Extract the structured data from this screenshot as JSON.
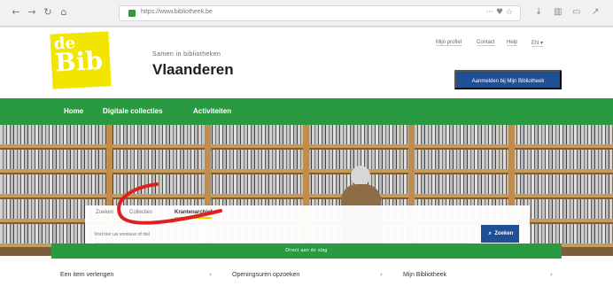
{
  "browser": {
    "nav_icons": [
      "←",
      "→",
      "↻",
      "⌂"
    ],
    "url": "https://www.bibliotheek.be",
    "url_right": "··· ♥ ☆",
    "toolbar_icons": [
      "↓",
      "▥",
      "▭",
      "↗"
    ]
  },
  "header": {
    "logo_line1": "de",
    "logo_line2": "Bib",
    "subtitle": "Samen in bibliotheken",
    "title": "Vlaanderen",
    "utility_links": [
      "Mijn profiel",
      "Contact",
      "Help",
      "EN ▾"
    ],
    "login_label": "Aanmelden bij Mijn Bibliotheek"
  },
  "main_nav": {
    "items": [
      "Home",
      "Digitale collecties",
      "Activiteiten"
    ]
  },
  "search": {
    "tabs": [
      "Zoeken",
      "Collecties",
      "Krantenarchief"
    ],
    "active_tab": "Krantenarchief",
    "placeholder": "Vind hier uw voorkeur of titel",
    "button_label": "Zoeken",
    "search_icon": "search-icon"
  },
  "banner": {
    "label": "Direct aan de slag"
  },
  "quick_links": {
    "items": [
      {
        "label": "Een item verlengen",
        "chevron": "›"
      },
      {
        "label": "Openingsuren opzoeken",
        "chevron": "›"
      },
      {
        "label": "Mijn Bibliotheek",
        "chevron": "›"
      }
    ]
  },
  "colors": {
    "logo_yellow": "#f2e500",
    "brand_green": "#2a9a42",
    "button_blue": "#1f4f95",
    "annotation_red": "#df2020"
  }
}
